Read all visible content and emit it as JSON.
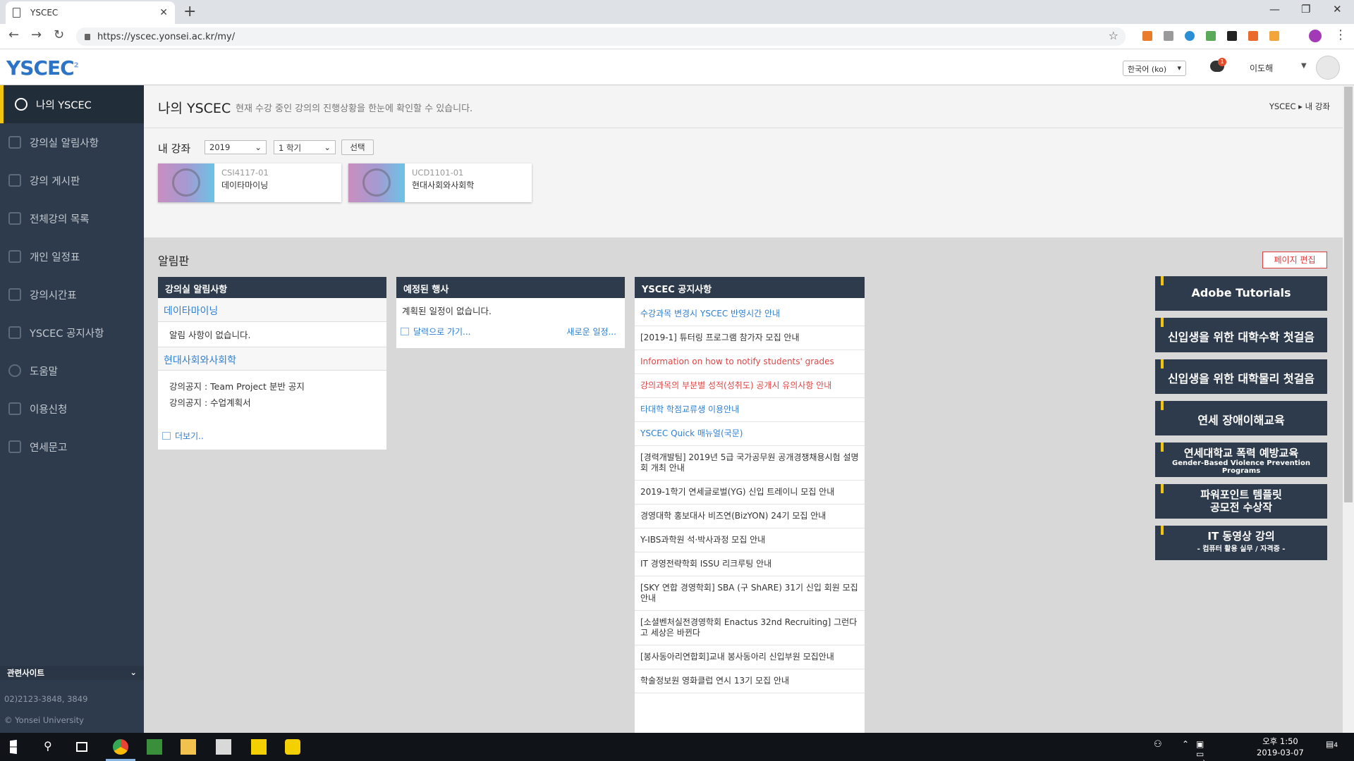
{
  "browser": {
    "tab_title": "YSCEC",
    "url": "https://yscec.yonsei.ac.kr/my/"
  },
  "header": {
    "logo": "YSCEC",
    "logo_sup": "2",
    "language": "한국어 (ko)",
    "notification_count": "1",
    "user_name": "이도해"
  },
  "sidebar": {
    "items": [
      {
        "label": "나의 YSCEC",
        "active": true
      },
      {
        "label": "강의실 알림사항"
      },
      {
        "label": "강의 게시판"
      },
      {
        "label": "전체강의 목록"
      },
      {
        "label": "개인 일정표"
      },
      {
        "label": "강의시간표"
      },
      {
        "label": "YSCEC 공지사항"
      },
      {
        "label": "도움말"
      },
      {
        "label": "이용신청"
      },
      {
        "label": "연세문고"
      }
    ],
    "related_sites": "관련사이트",
    "phone": "02)2123-3848, 3849",
    "copyright": "© Yonsei University"
  },
  "main": {
    "title": "나의 YSCEC",
    "description": "현재 수강 중인 강의의 진행상황을 한눈에 확인할 수 있습니다.",
    "breadcrumb": "YSCEC ▸ 내 강좌",
    "my_courses_label": "내 강좌",
    "year": "2019",
    "semester": "1 학기",
    "select_button": "선택",
    "courses": [
      {
        "code": "CSI4117-01",
        "name": "데이타마이닝"
      },
      {
        "code": "UCD1101-01",
        "name": "현대사회와사회학"
      }
    ],
    "board_label": "알림판",
    "edit_page": "페이지 편집"
  },
  "course_notices": {
    "title": "강의실 알림사항",
    "course1": "데이타마이닝",
    "course1_empty": "알림 사항이 없습니다.",
    "course2": "현대사회와사회학",
    "course2_items": [
      "강의공지 : Team Project 분반 공지",
      "강의공지 : 수업계획서"
    ],
    "more": "더보기.."
  },
  "events": {
    "title": "예정된 행사",
    "empty": "계획된 일정이 없습니다.",
    "go_calendar": "달력으로 가기...",
    "new_event": "새로운 일정..."
  },
  "yscec_notices": {
    "title": "YSCEC 공지사항",
    "items": [
      {
        "text": "수강과목 변경시 YSCEC 반영시간 안내",
        "color": "blue"
      },
      {
        "text": "[2019-1] 튜터링 프로그램 참가자 모집 안내",
        "color": "normal"
      },
      {
        "text": "Information on how to notify students' grades",
        "color": "red"
      },
      {
        "text": "강의과목의 부분별 성적(성취도) 공개시 유의사항 안내",
        "color": "red"
      },
      {
        "text": "타대학 학점교류생 이용안내",
        "color": "blue"
      },
      {
        "text": "YSCEC Quick 매뉴얼(국문)",
        "color": "blue"
      },
      {
        "text": "[경력개발팀] 2019년 5급 국가공무원 공개경쟁채용시험 설명회 개최 안내",
        "color": "normal"
      },
      {
        "text": "2019-1학기 연세글로벌(YG) 신입 트레이니 모집 안내",
        "color": "normal"
      },
      {
        "text": "경영대학 홍보대사 비즈연(BizYON) 24기 모집 안내",
        "color": "normal"
      },
      {
        "text": "Y-IBS과학원 석·박사과정 모집 안내",
        "color": "normal"
      },
      {
        "text": "IT 경영전략학회 ISSU 리크루팅 안내",
        "color": "normal"
      },
      {
        "text": "[SKY 연합 경영학회] SBA (구 ShARE) 31기 신입 회원 모집 안내",
        "color": "normal"
      },
      {
        "text": "[소셜벤처실전경영학회 Enactus 32nd Recruiting] 그런다고 세상은 바뀐다",
        "color": "normal"
      },
      {
        "text": "[봉사동아리연합회]교내 봉사동아리 신입부원 모집안내",
        "color": "normal"
      },
      {
        "text": "학술정보원 영화클럽 연시 13기 모집 안내",
        "color": "normal"
      }
    ]
  },
  "promos": [
    {
      "title": "Adobe Tutorials"
    },
    {
      "title": "신입생을 위한 대학수학 첫걸음"
    },
    {
      "title": "신입생을 위한 대학물리 첫걸음"
    },
    {
      "title": "연세 장애이해교육"
    },
    {
      "title": "연세대학교 폭력 예방교육",
      "sub": "Gender-Based Violence Prevention Programs"
    },
    {
      "title": "파워포인트 템플릿",
      "title2": "공모전 수상작"
    },
    {
      "title": "IT 동영상 강의",
      "sub": "- 컴퓨터 활용 실무 / 자격증 -"
    }
  ],
  "taskbar": {
    "time": "오후 1:50",
    "date": "2019-03-07",
    "notif_count": "4"
  },
  "colors": {
    "sidebar_bg": "#2e3b4c",
    "accent_yellow": "#f1c40f",
    "link_blue": "#2f7fd2",
    "alert_red": "#e04545"
  }
}
